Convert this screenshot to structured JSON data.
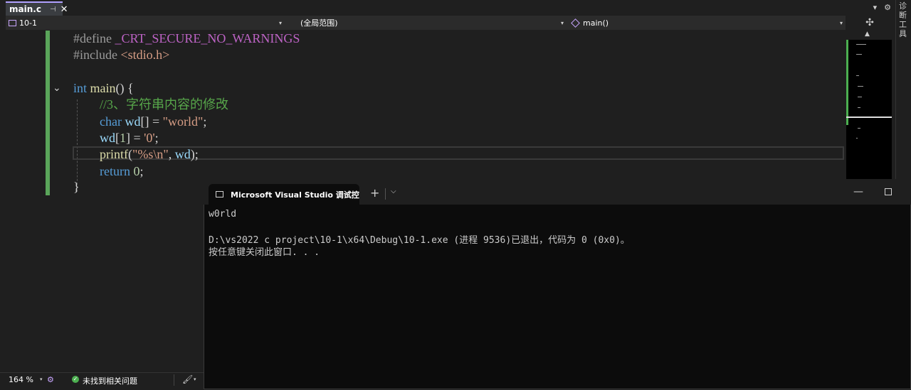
{
  "tab": {
    "label": "main.c",
    "pin_icon": "pin-icon",
    "close_icon": "close-icon"
  },
  "tabstrip_right": {
    "dropdown_glyph": "▾",
    "settings_glyph": "⚙"
  },
  "side_strip": {
    "label": "诊断工具"
  },
  "nav": {
    "project": "10-1",
    "scope": "(全局范围)",
    "member": "main()",
    "arrow": "▾",
    "split_glyph": "✣"
  },
  "code": {
    "line1": {
      "directive": "#define",
      "macro": "_CRT_SECURE_NO_WARNINGS"
    },
    "line2": {
      "directive": "#include",
      "header": "<stdio.h>"
    },
    "line4": {
      "type": "int",
      "name": "main",
      "rest": "() {"
    },
    "line5": {
      "comment": "//3、字符串内容的修改"
    },
    "line6": {
      "type": "char",
      "var": "wd",
      "mid": "[] = ",
      "str": "\"world\"",
      "end": ";"
    },
    "line7": {
      "var": "wd",
      "open": "[",
      "idx": "1",
      "mid": "] = ",
      "chr": "'0'",
      "end": ";"
    },
    "line8": {
      "fn": "printf",
      "open": "(",
      "fmt": "\"%s\\n\"",
      "sep": ", ",
      "var": "wd",
      "end": ");"
    },
    "line9": {
      "kw": "return",
      "val": "0",
      "end": ";"
    },
    "line10": {
      "brace": "}"
    }
  },
  "terminal": {
    "tab_title": "Microsoft Visual Studio 调试控",
    "plus": "+",
    "chevron": "⌵",
    "minimize": "—",
    "output_line1": "w0rld",
    "output_line2": "D:\\vs2022 c project\\10-1\\x64\\Debug\\10-1.exe (进程 9536)已退出，代码为 0 (0x0)。",
    "output_line3": "按任意键关闭此窗口. . ."
  },
  "status": {
    "zoom": "164 %",
    "issues": "未找到相关问题",
    "arrow": "▾",
    "ok_glyph": "✓",
    "brush_glyph": "🖌"
  },
  "colors": {
    "accent": "#b0a0ff",
    "change_bar": "#5aa55a",
    "keyword": "#569cd6",
    "comment": "#57a64a",
    "string": "#d69d85"
  }
}
